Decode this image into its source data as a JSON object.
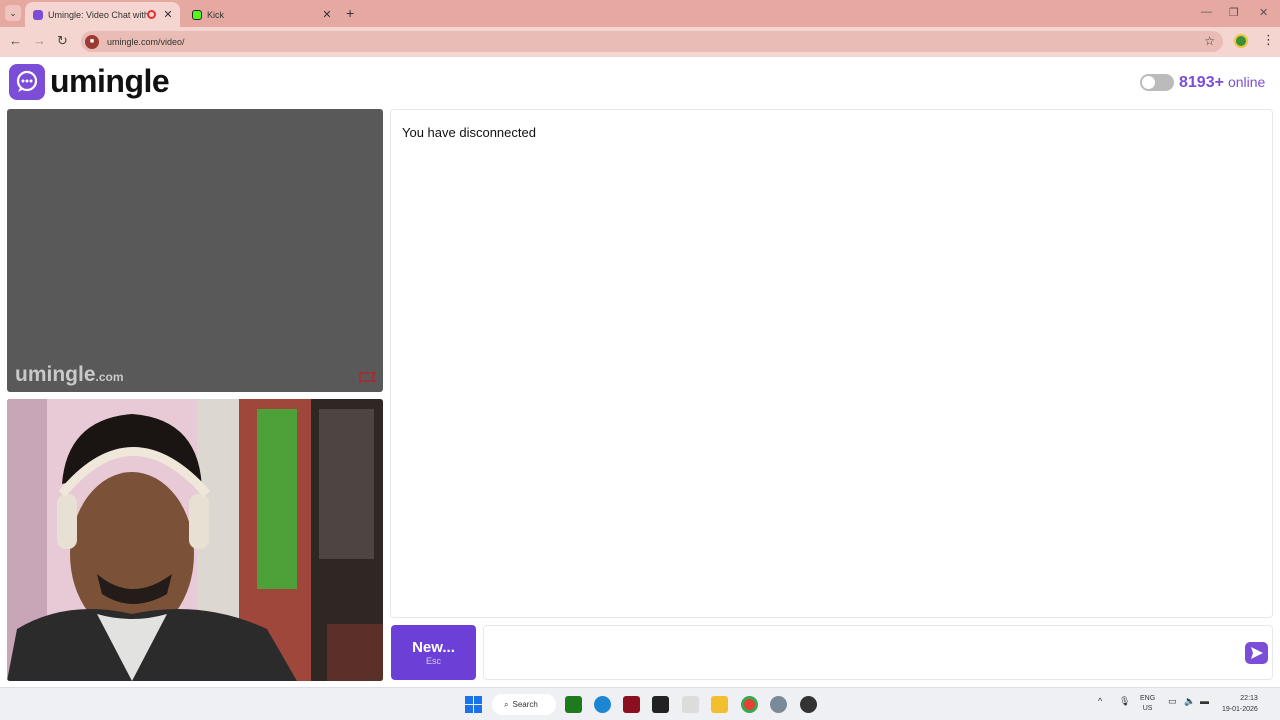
{
  "browser": {
    "tabs": [
      {
        "title": "Umingle: Video Chat with S",
        "active": true
      },
      {
        "title": "Kick",
        "active": false
      }
    ],
    "url": "umingle.com/video/"
  },
  "header": {
    "brand": "umingle",
    "online_count": "8193+",
    "online_label": "online"
  },
  "video": {
    "watermark_brand": "umingle",
    "watermark_suffix": ".com"
  },
  "chat": {
    "status_message": "You have disconnected",
    "new_button_label": "New...",
    "new_button_hint": "Esc",
    "input_placeholder": ""
  },
  "taskbar": {
    "search_label": "Search",
    "lang_line1": "ENG",
    "lang_line2": "US",
    "time": "22:13",
    "date": "19-01-2026"
  },
  "colors": {
    "brand_purple": "#7c4dd6",
    "tab_strip": "#e6a9a1"
  }
}
